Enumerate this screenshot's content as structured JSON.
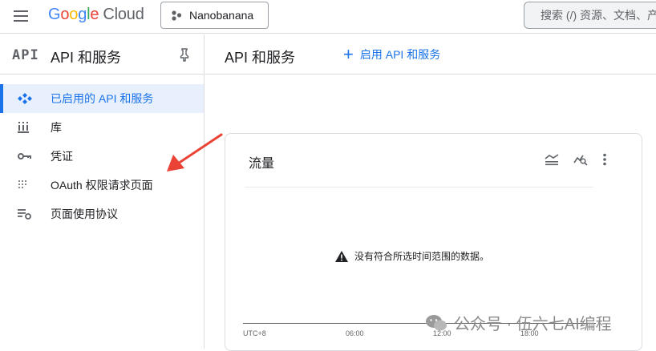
{
  "header": {
    "logo_google": "Google",
    "logo_cloud": "Cloud",
    "project_name": "Nanobanana",
    "search_placeholder": "搜索 (/) 资源、文档、产"
  },
  "sidebar": {
    "api_mark": "API",
    "title": "API 和服务",
    "items": [
      {
        "label": "已启用的 API 和服务",
        "icon": "api-diamond-icon",
        "active": true
      },
      {
        "label": "库",
        "icon": "library-icon",
        "active": false
      },
      {
        "label": "凭证",
        "icon": "key-icon",
        "active": false
      },
      {
        "label": "OAuth 权限请求页面",
        "icon": "oauth-consent-icon",
        "active": false
      },
      {
        "label": "页面使用协议",
        "icon": "page-usage-settings-icon",
        "active": false
      }
    ]
  },
  "main": {
    "title": "API 和服务",
    "enable_button": "启用 API 和服务"
  },
  "traffic_card": {
    "title": "流量",
    "no_data_message": "没有符合所选时间范围的数据。",
    "x_ticks": [
      "UTC+8",
      "06:00",
      "12:00",
      "18:00"
    ]
  },
  "colors": {
    "accent": "#1a73e8",
    "active_bg": "#e8f0fe",
    "arrow": "#ea4335"
  },
  "watermark": "公众号 · 伍六七AI编程"
}
